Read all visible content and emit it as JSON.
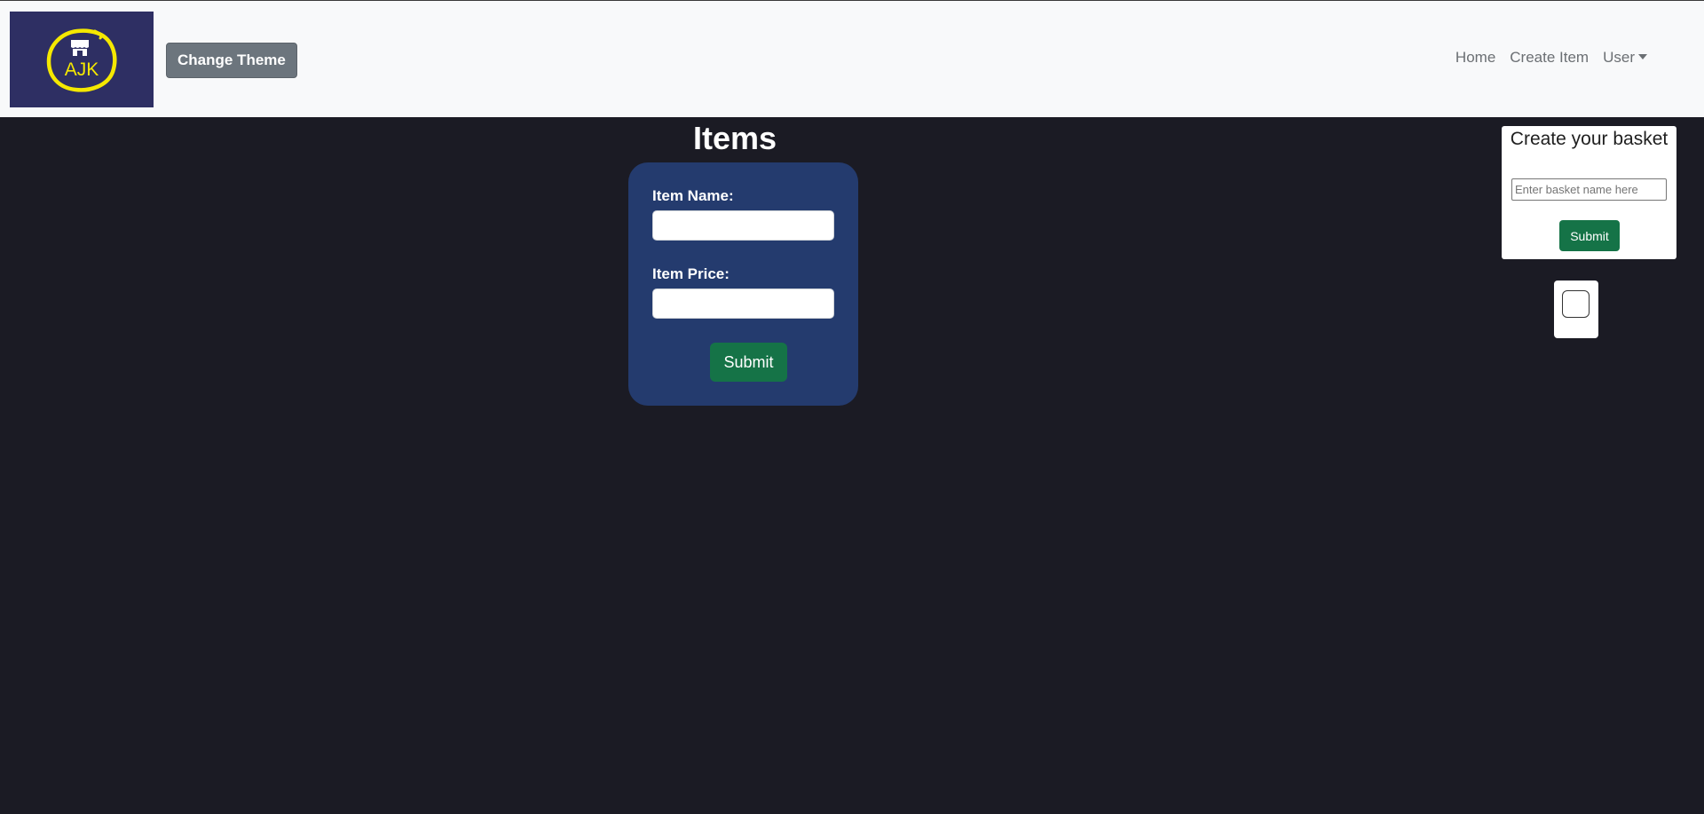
{
  "colors": {
    "navbar_bg": "#f8f9fa",
    "page_bg": "#1b1b24",
    "card_bg": "#243b6e",
    "success": "#157347",
    "secondary": "#6c757d",
    "logo_bg": "#2e2f63",
    "logo_accent": "#f5e800"
  },
  "logo": {
    "text": "AJK",
    "icon": "shop-icon"
  },
  "navbar": {
    "theme_button": "Change Theme",
    "links": {
      "home": "Home",
      "create_item": "Create Item",
      "user": "User"
    }
  },
  "main": {
    "title": "Items",
    "form": {
      "item_name_label": "Item Name:",
      "item_name_value": "",
      "item_price_label": "Item Price:",
      "item_price_value": "",
      "submit_label": "Submit"
    }
  },
  "basket": {
    "title": "Create your basket",
    "placeholder": "Enter basket name here",
    "submit_label": "Submit"
  },
  "checkbox": {
    "checked": false
  }
}
